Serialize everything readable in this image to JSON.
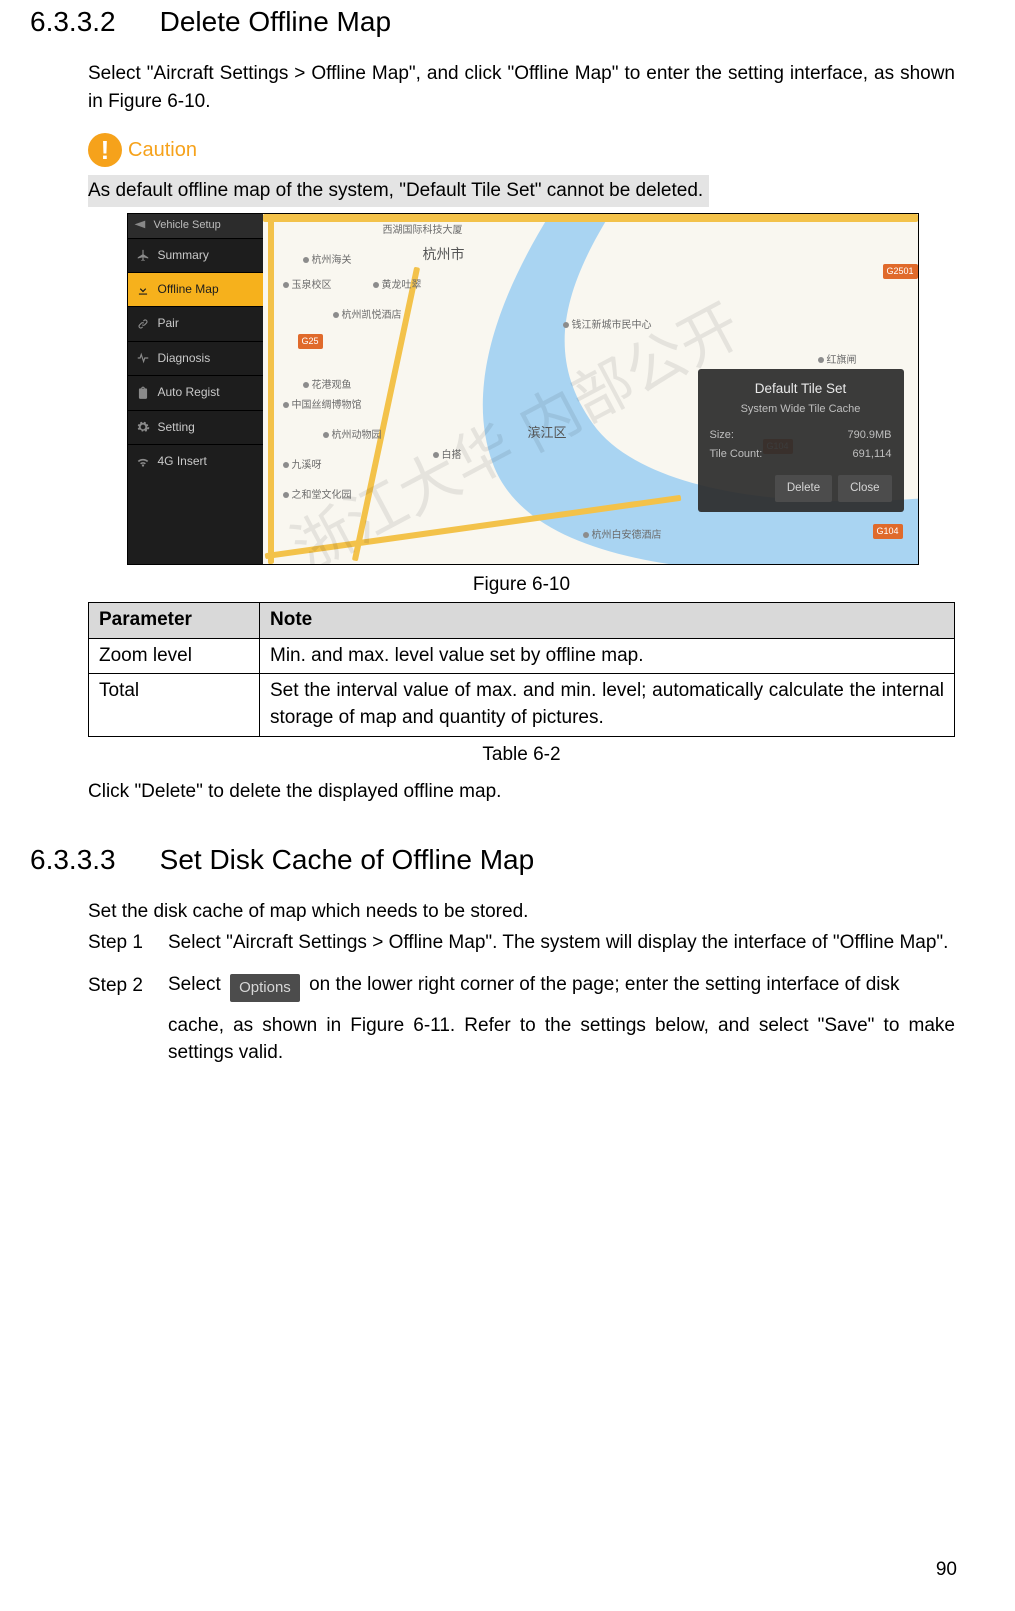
{
  "section_6332": {
    "number": "6.3.3.2",
    "title": "Delete Offline Map",
    "intro": "Select \"Aircraft Settings > Offline Map\", and click \"Offline Map\" to enter the setting interface, as shown in Figure 6-10.",
    "caution_label": "Caution",
    "caution_text": "As default offline map of the system, \"Default Tile Set\" cannot be deleted.",
    "figure_caption": "Figure 6-10",
    "table_header_param": "Parameter",
    "table_header_note": "Note",
    "table_rows": [
      {
        "param": "Zoom level",
        "note": "Min. and max. level value set by offline map."
      },
      {
        "param": "Total",
        "note": "Set the interval value of max. and min. level; automatically calculate the internal storage of map and quantity of pictures."
      }
    ],
    "table_caption": "Table 6-2",
    "after_table": "Click \"Delete\" to delete the displayed offline map."
  },
  "section_6333": {
    "number": "6.3.3.3",
    "title": "Set Disk Cache of Offline Map",
    "intro": "Set the disk cache of map which needs to be stored.",
    "step1_label": "Step 1",
    "step1_text": "Select \"Aircraft Settings > Offline Map\". The system will display the interface of \"Offline Map\".",
    "step2_label": "Step 2",
    "step2_pre": "Select",
    "step2_chip": "Options",
    "step2_mid": "on the lower right corner of the page; enter the setting interface of disk",
    "step2_tail": "cache, as shown in Figure 6-11. Refer to the settings below, and select \"Save\" to make settings valid."
  },
  "screenshot": {
    "sidebar_header": "Vehicle Setup",
    "sidebar_items": [
      {
        "label": "Summary"
      },
      {
        "label": "Offline Map"
      },
      {
        "label": "Pair"
      },
      {
        "label": "Diagnosis"
      },
      {
        "label": "Auto Regist"
      },
      {
        "label": "Setting"
      },
      {
        "label": "4G Insert"
      }
    ],
    "card": {
      "title": "Default Tile Set",
      "subtitle": "System Wide Tile Cache",
      "size_label": "Size:",
      "size_value": "790.9MB",
      "tile_label": "Tile Count:",
      "tile_value": "691,114",
      "btn_delete": "Delete",
      "btn_close": "Close"
    },
    "pois": {
      "a": "西湖国际科技大厦",
      "b": "杭州市",
      "c": "杭州海关",
      "d": "玉泉校区",
      "e": "黄龙吐翠",
      "f": "杭州凯悦酒店",
      "g": "中国丝绸博物馆",
      "h": "钱江新城市民中心",
      "i": "花港观鱼",
      "j": "杭州动物园",
      "k": "九溪呀",
      "l": "白搭",
      "m": "滨江区",
      "n": "之和堂文化园",
      "o": "杭州白安德酒店",
      "p": "红旗闸"
    },
    "badges": {
      "g104a": "G104",
      "g2501": "G2501",
      "g104b": "G104",
      "g25": "G25"
    }
  },
  "watermark": "浙江大华 内部公开",
  "page_number": "90"
}
